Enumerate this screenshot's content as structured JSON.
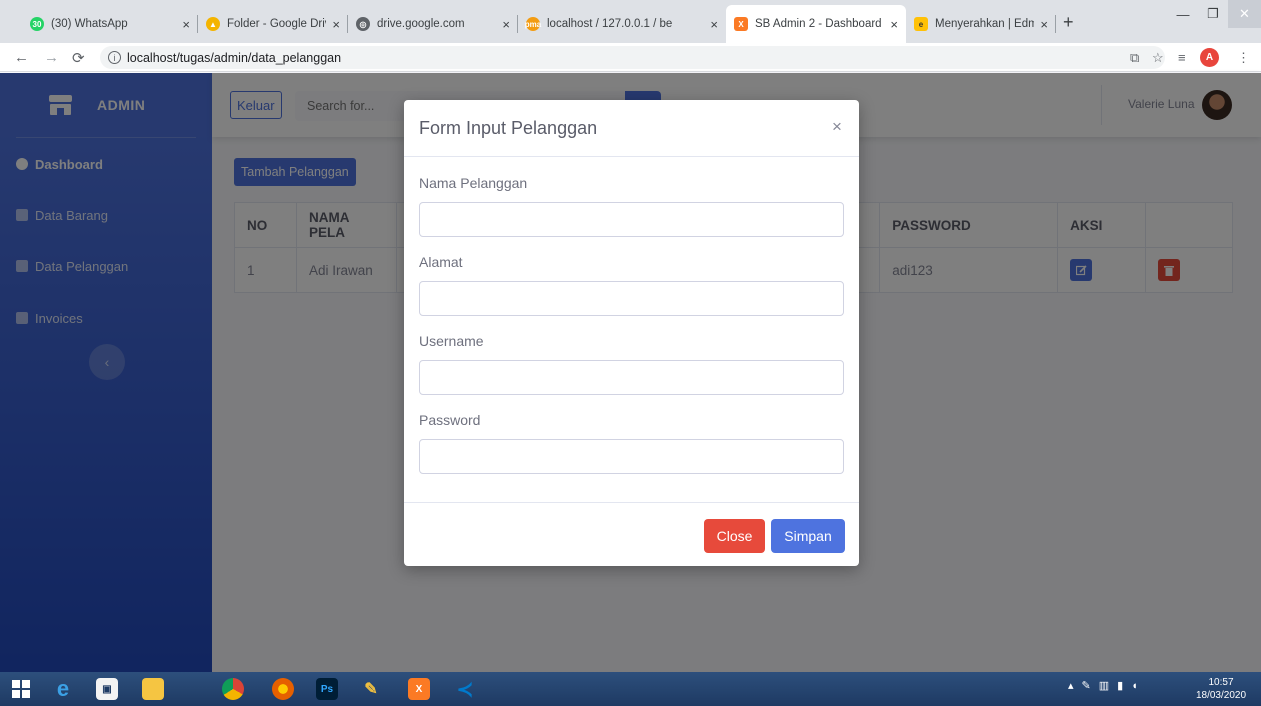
{
  "browser": {
    "tabs": [
      {
        "label": "(30) WhatsApp",
        "favicon_color": "#25d366",
        "favicon_glyph": "30"
      },
      {
        "label": "Folder - Google Drive",
        "favicon_color": "#f4b400",
        "favicon_glyph": "▲"
      },
      {
        "label": "drive.google.com",
        "favicon_color": "#5f6368",
        "favicon_glyph": "◎"
      },
      {
        "label": "localhost / 127.0.0.1 / be",
        "favicon_color": "#f39c12",
        "favicon_glyph": "pma"
      },
      {
        "label": "SB Admin 2 - Dashboard",
        "favicon_color": "#fb7a24",
        "favicon_glyph": "X"
      },
      {
        "label": "Menyerahkan | Edmodo",
        "favicon_color": "#ffc107",
        "favicon_glyph": "e"
      }
    ],
    "close_glyph": "×",
    "new_tab_glyph": "+",
    "url": "localhost/tugas/admin/data_pelanggan",
    "profile_initial": "A"
  },
  "sidebar": {
    "brand": "ADMIN",
    "items": [
      {
        "label": "Dashboard",
        "active": true
      },
      {
        "label": "Data Barang",
        "active": false
      },
      {
        "label": "Data Pelanggan",
        "active": false
      },
      {
        "label": "Invoices",
        "active": false
      }
    ],
    "toggle_glyph": "‹"
  },
  "topbar": {
    "keluar_label": "Keluar",
    "search_placeholder": "Search for...",
    "user_name": "Valerie Luna"
  },
  "content": {
    "add_button": "Tambah Pelanggan",
    "table": {
      "headers": [
        "NO",
        "NAMA PELA",
        "",
        "PASSWORD",
        "AKSI",
        ""
      ],
      "rows": [
        {
          "no": "1",
          "nama": "Adi Irawan",
          "password": "adi123"
        }
      ]
    }
  },
  "modal": {
    "title": "Form Input Pelanggan",
    "close_glyph": "×",
    "fields": [
      {
        "label": "Nama Pelanggan",
        "value": ""
      },
      {
        "label": "Alamat",
        "value": ""
      },
      {
        "label": "Username",
        "value": ""
      },
      {
        "label": "Password",
        "value": ""
      }
    ],
    "close_button": "Close",
    "save_button": "Simpan"
  },
  "taskbar": {
    "time": "10:57",
    "date": "18/03/2020"
  },
  "colors": {
    "primary": "#4e73df",
    "danger": "#e74a3b",
    "sidebar_dark": "#224abe"
  }
}
